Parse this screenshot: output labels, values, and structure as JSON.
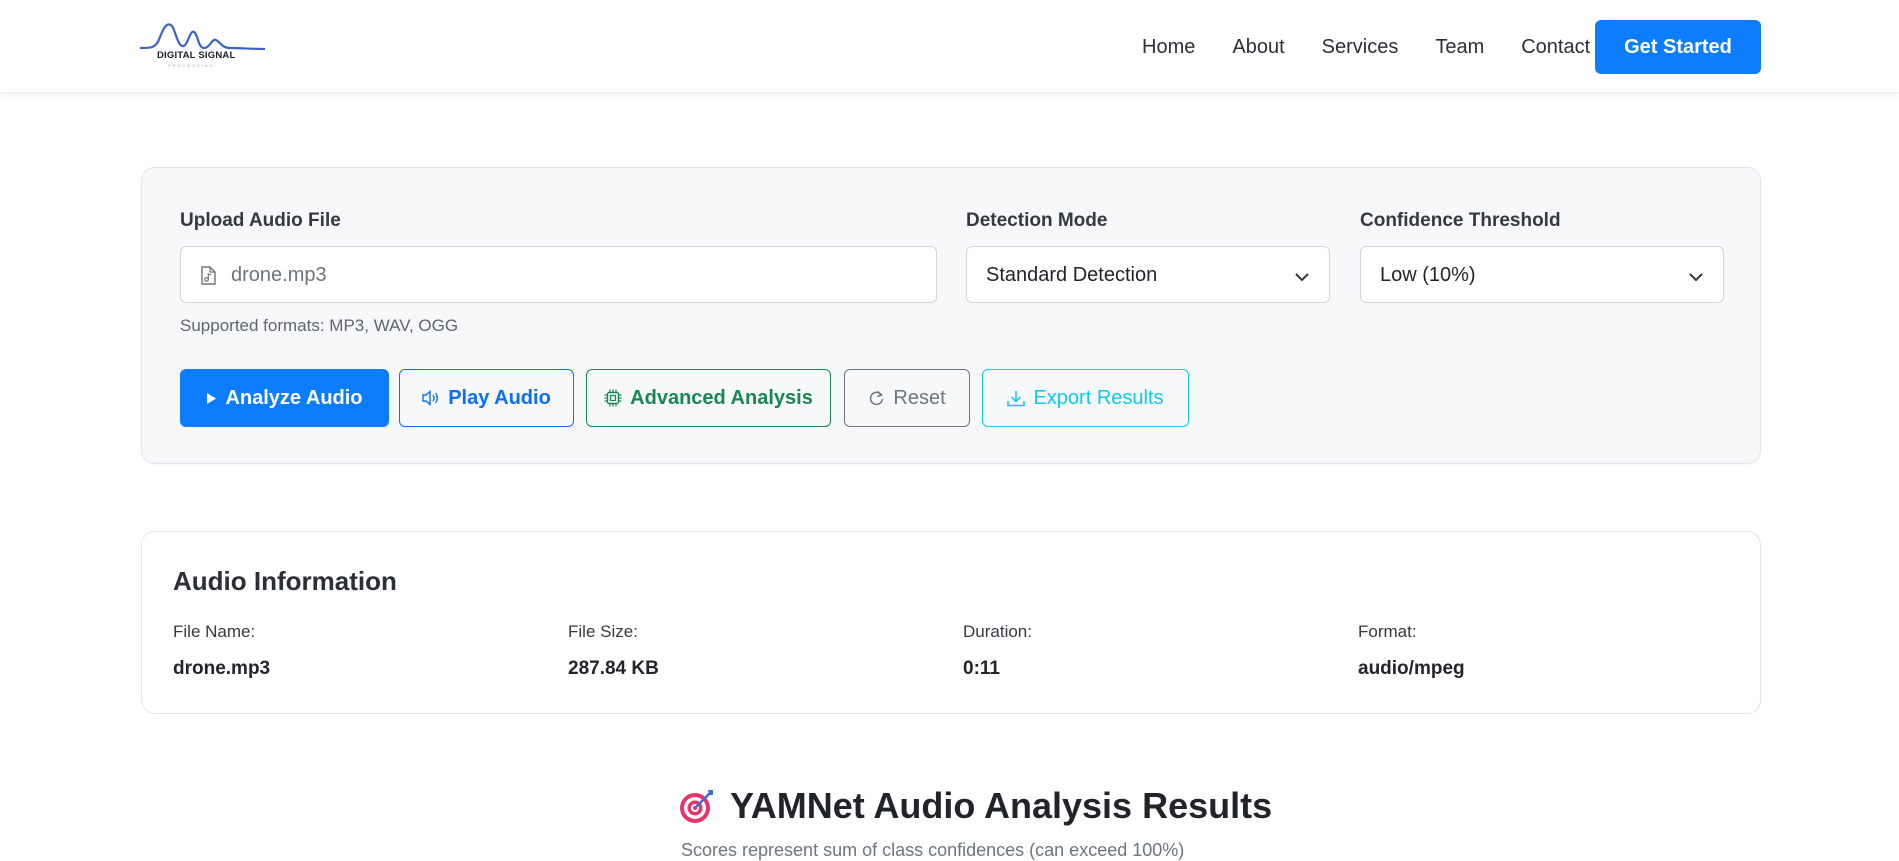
{
  "brand": {
    "logo_text": "DIGITAL SIGNAL",
    "logo_subtext": "PROCESSING",
    "accent_color": "#0d7dff"
  },
  "nav": {
    "links": [
      "Home",
      "About",
      "Services",
      "Team",
      "Contact"
    ],
    "cta_label": "Get Started"
  },
  "controls": {
    "upload": {
      "label": "Upload Audio File",
      "file_value": "drone.mp3",
      "icon": "music-file-icon",
      "help": "Supported formats: MP3, WAV, OGG"
    },
    "detection_mode": {
      "label": "Detection Mode",
      "selected": "Standard Detection"
    },
    "confidence": {
      "label": "Confidence Threshold",
      "selected": "Low (10%)"
    },
    "buttons": {
      "analyze": "Analyze Audio",
      "play": "Play Audio",
      "advanced": "Advanced Analysis",
      "reset": "Reset",
      "export": "Export Results"
    }
  },
  "audio_info": {
    "title": "Audio Information",
    "fields": [
      {
        "label": "File Name:",
        "value": "drone.mp3"
      },
      {
        "label": "File Size:",
        "value": "287.84 KB"
      },
      {
        "label": "Duration:",
        "value": "0:11"
      },
      {
        "label": "Format:",
        "value": "audio/mpeg"
      }
    ]
  },
  "results": {
    "icon": "target-icon",
    "title": "YAMNet Audio Analysis Results",
    "subtitle": "Scores represent sum of class confidences (can exceed 100%)"
  }
}
